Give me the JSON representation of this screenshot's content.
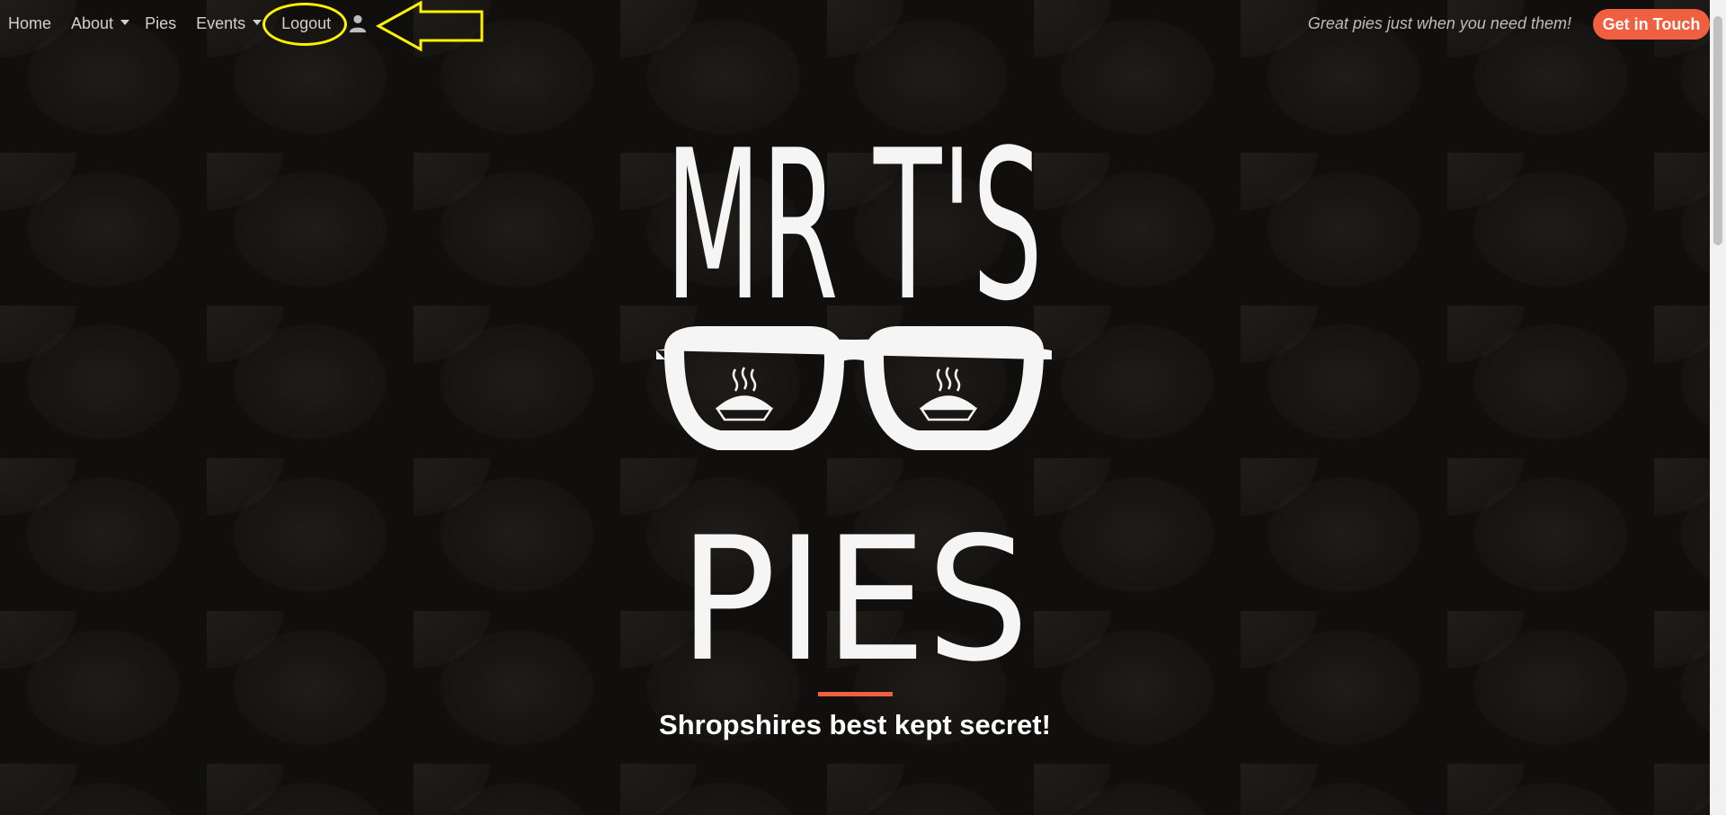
{
  "nav": {
    "items": [
      {
        "label": "Home",
        "has_dropdown": false
      },
      {
        "label": "About",
        "has_dropdown": true
      },
      {
        "label": "Pies",
        "has_dropdown": false
      },
      {
        "label": "Events",
        "has_dropdown": true
      },
      {
        "label": "Logout",
        "has_dropdown": false
      }
    ],
    "user_icon": "user-icon",
    "tagline": "Great pies just when you need them!",
    "cta_label": "Get in Touch"
  },
  "logo": {
    "line1": "MR T'S",
    "line2": "PIES",
    "glasses_icon": "glasses-with-pies"
  },
  "hero": {
    "heading": "Shropshires best kept secret!"
  },
  "colors": {
    "accent": "#f05f40",
    "annotation": "#fff200",
    "background": "#1b1815",
    "nav_text": "#d0d0d0"
  }
}
